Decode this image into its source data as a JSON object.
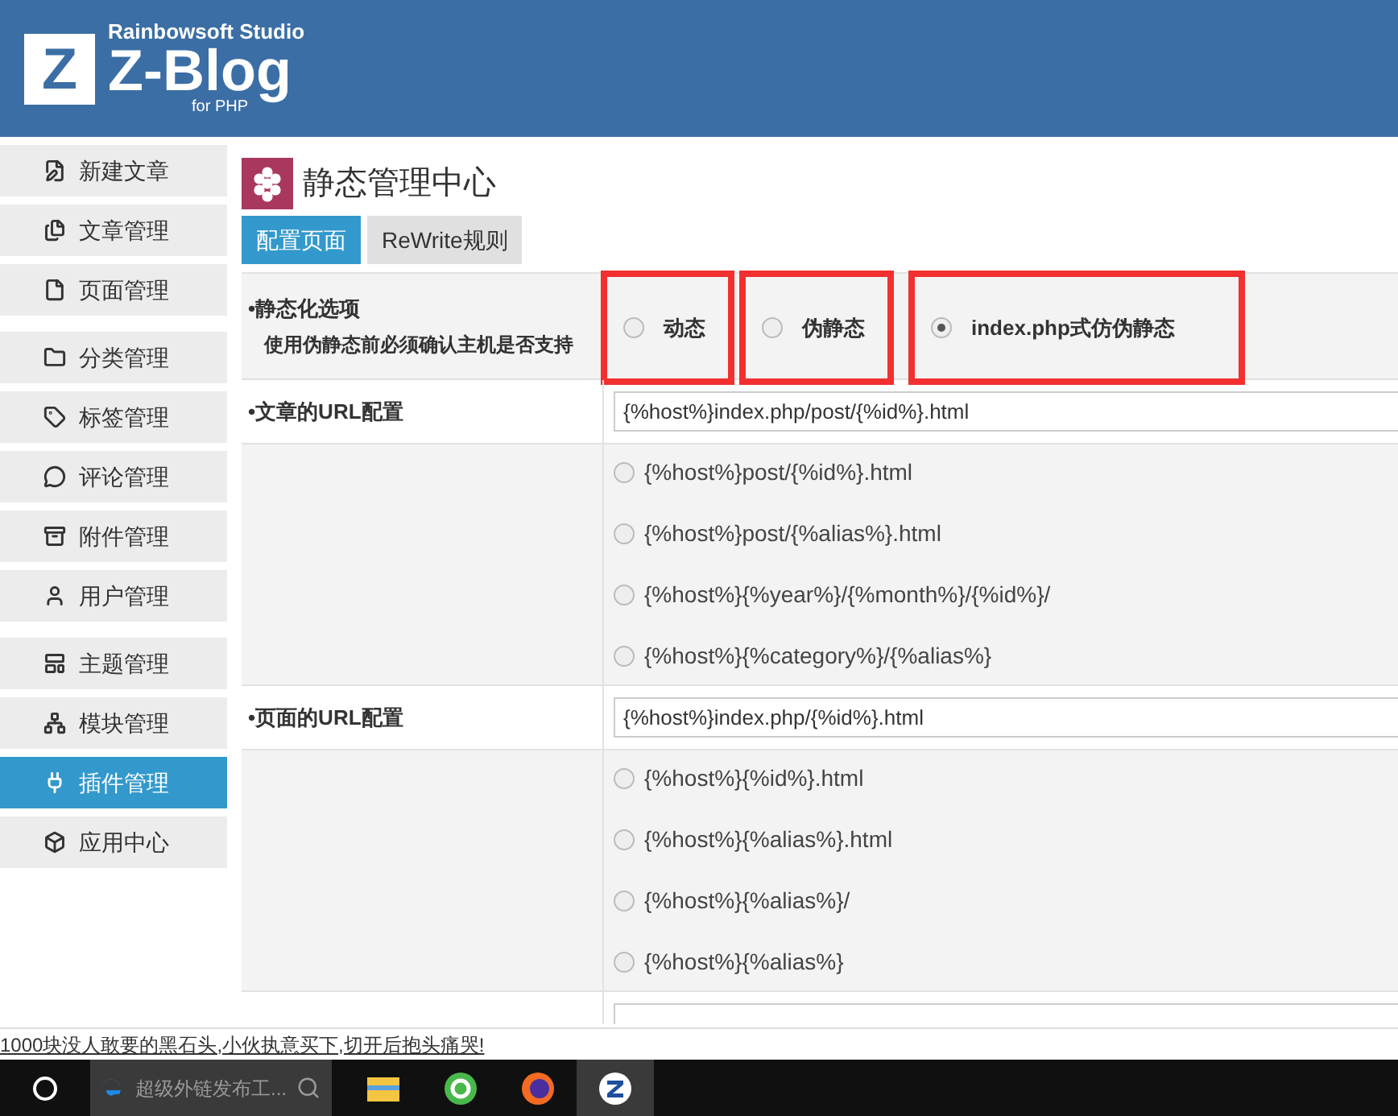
{
  "header": {
    "studio": "Rainbowsoft Studio",
    "logo_letter": "Z",
    "brand": "Z-Blog",
    "sub": "for PHP"
  },
  "sidebar": {
    "groups": [
      [
        {
          "label": "新建文章",
          "selected": false
        },
        {
          "label": "文章管理",
          "selected": false
        },
        {
          "label": "页面管理",
          "selected": false
        }
      ],
      [
        {
          "label": "分类管理",
          "selected": false
        },
        {
          "label": "标签管理",
          "selected": false
        },
        {
          "label": "评论管理",
          "selected": false
        },
        {
          "label": "附件管理",
          "selected": false
        },
        {
          "label": "用户管理",
          "selected": false
        }
      ],
      [
        {
          "label": "主题管理",
          "selected": false
        },
        {
          "label": "模块管理",
          "selected": false
        },
        {
          "label": "插件管理",
          "selected": true
        },
        {
          "label": "应用中心",
          "selected": false
        }
      ]
    ]
  },
  "page_title": "静态管理中心",
  "tabs": [
    {
      "label": "配置页面",
      "selected": true
    },
    {
      "label": "ReWrite规则",
      "selected": false
    }
  ],
  "mode": {
    "label": "•静态化选项",
    "hint": "使用伪静态前必须确认主机是否支持",
    "options": [
      {
        "label": "动态",
        "selected": false,
        "highlighted": true
      },
      {
        "label": "伪静态",
        "selected": false,
        "highlighted": true
      },
      {
        "label": "index.php式仿伪静态",
        "selected": true,
        "highlighted": true
      }
    ]
  },
  "sections": [
    {
      "label": "•文章的URL配置",
      "value": "{%host%}index.php/post/{%id%}.html",
      "options": [
        {
          "label": "{%host%}post/{%id%}.html",
          "selected": false
        },
        {
          "label": "{%host%}post/{%alias%}.html",
          "selected": false
        },
        {
          "label": "{%host%}{%year%}/{%month%}/{%id%}/",
          "selected": false
        },
        {
          "label": "{%host%}{%category%}/{%alias%}",
          "selected": false
        }
      ]
    },
    {
      "label": "•页面的URL配置",
      "value": "{%host%}index.php/{%id%}.html",
      "options": [
        {
          "label": "{%host%}{%id%}.html",
          "selected": false
        },
        {
          "label": "{%host%}{%alias%}.html",
          "selected": false
        },
        {
          "label": "{%host%}{%alias%}/",
          "selected": false
        },
        {
          "label": "{%host%}{%alias%}",
          "selected": false
        }
      ]
    }
  ],
  "status_link": "1000块没人敢要的黑石头,小伙执意买下,切开后抱头痛哭!",
  "taskbar": {
    "search_placeholder": "超级外链发布工...",
    "apps": [
      {
        "selected": false
      },
      {
        "selected": false
      },
      {
        "selected": false
      },
      {
        "selected": true
      }
    ]
  }
}
